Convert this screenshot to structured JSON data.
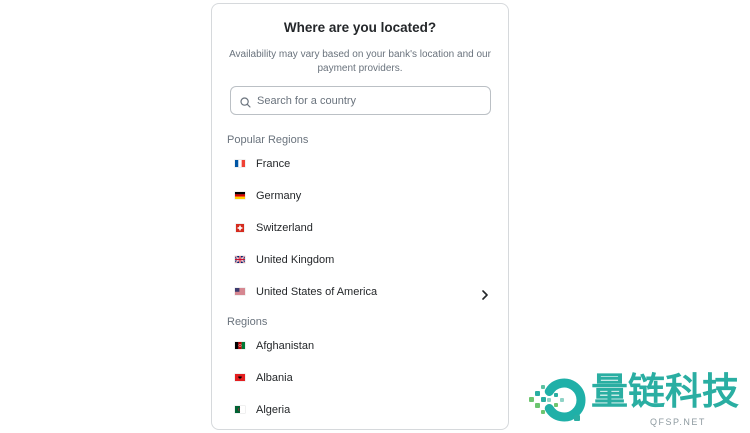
{
  "dialog": {
    "title": "Where are you located?",
    "subtitle": "Availability may vary based on your bank's location and our payment providers."
  },
  "search": {
    "placeholder": "Search for a country",
    "icon": "search-icon"
  },
  "popular_regions": {
    "heading": "Popular Regions",
    "items": [
      {
        "label": "France",
        "flag_icon": "france-flag-icon"
      },
      {
        "label": "Germany",
        "flag_icon": "germany-flag-icon"
      },
      {
        "label": "Switzerland",
        "flag_icon": "switzerland-flag-icon"
      },
      {
        "label": "United Kingdom",
        "flag_icon": "united-kingdom-flag-icon"
      },
      {
        "label": "United States of America",
        "flag_icon": "usa-flag-icon",
        "trailing_icon": "chevron-right-icon"
      }
    ]
  },
  "regions": {
    "heading": "Regions",
    "items": [
      {
        "label": "Afghanistan",
        "flag_icon": "afghanistan-flag-icon"
      },
      {
        "label": "Albania",
        "flag_icon": "albania-flag-icon"
      },
      {
        "label": "Algeria",
        "flag_icon": "algeria-flag-icon"
      }
    ]
  },
  "watermark": {
    "logo_icon": "qfsp-logo-icon",
    "brand_text": "量链科技",
    "domain": "QFSP.NET"
  },
  "colors": {
    "text_primary": "#24272a",
    "text_muted": "#6a737d",
    "border": "#d6d9dc",
    "brand_teal": "#2aaea2"
  }
}
